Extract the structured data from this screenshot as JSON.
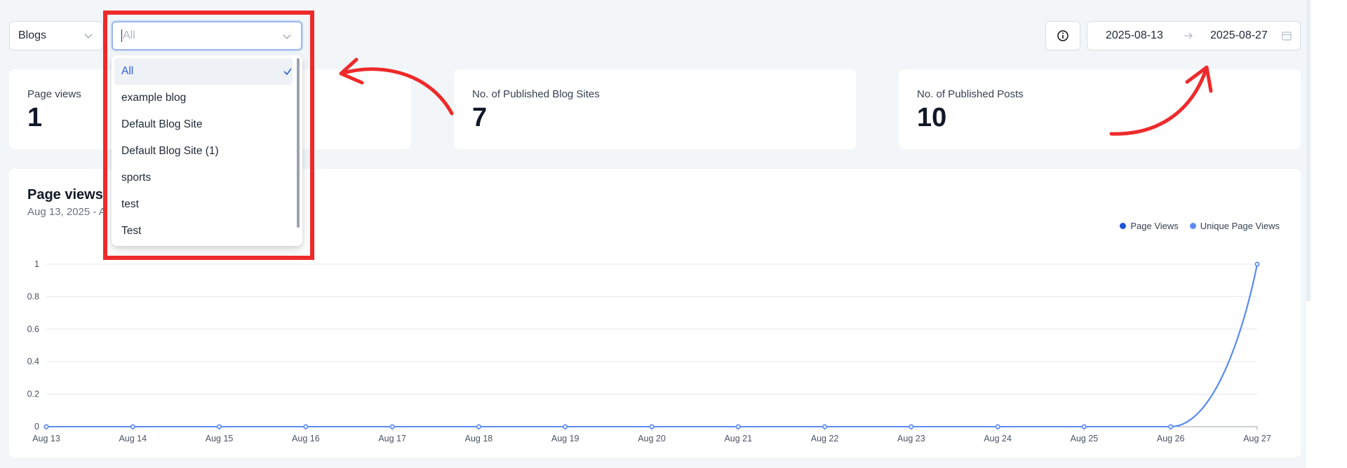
{
  "filters": {
    "content_type": "Blogs",
    "blog_selector_placeholder": "All"
  },
  "date_range": {
    "start": "2025-08-13",
    "end": "2025-08-27"
  },
  "stats": {
    "page_views": {
      "label": "Page views",
      "value": "1"
    },
    "published_sites": {
      "label": "No. of Published Blog Sites",
      "value": "7"
    },
    "published_posts": {
      "label": "No. of Published Posts",
      "value": "10"
    }
  },
  "chart_panel": {
    "title": "Page views",
    "subtitle": "Aug 13, 2025 - A"
  },
  "dropdown": {
    "options": [
      "All",
      "example blog",
      "Default Blog Site",
      "Default Blog Site (1)",
      "sports",
      "test",
      "Test"
    ],
    "selected": "All"
  },
  "colors": {
    "accent": "#2f61d0",
    "line": "#5b8def",
    "annotation": "#ee2a2a"
  },
  "chart_data": {
    "type": "line",
    "categories": [
      "Aug 13",
      "Aug 14",
      "Aug 15",
      "Aug 16",
      "Aug 17",
      "Aug 18",
      "Aug 19",
      "Aug 20",
      "Aug 21",
      "Aug 22",
      "Aug 23",
      "Aug 24",
      "Aug 25",
      "Aug 26",
      "Aug 27"
    ],
    "series": [
      {
        "name": "Page Views",
        "color": "#1f57d6",
        "values": [
          0,
          0,
          0,
          0,
          0,
          0,
          0,
          0,
          0,
          0,
          0,
          0,
          0,
          0,
          1
        ]
      },
      {
        "name": "Unique Page Views",
        "color": "#5b8def",
        "values": [
          0,
          0,
          0,
          0,
          0,
          0,
          0,
          0,
          0,
          0,
          0,
          0,
          0,
          0,
          1
        ]
      }
    ],
    "ylim": [
      0,
      1
    ],
    "yticks": [
      "1",
      "0.8",
      "0.6",
      "0.4",
      "0.2",
      "0"
    ],
    "grid": true,
    "legend": "top-right"
  }
}
